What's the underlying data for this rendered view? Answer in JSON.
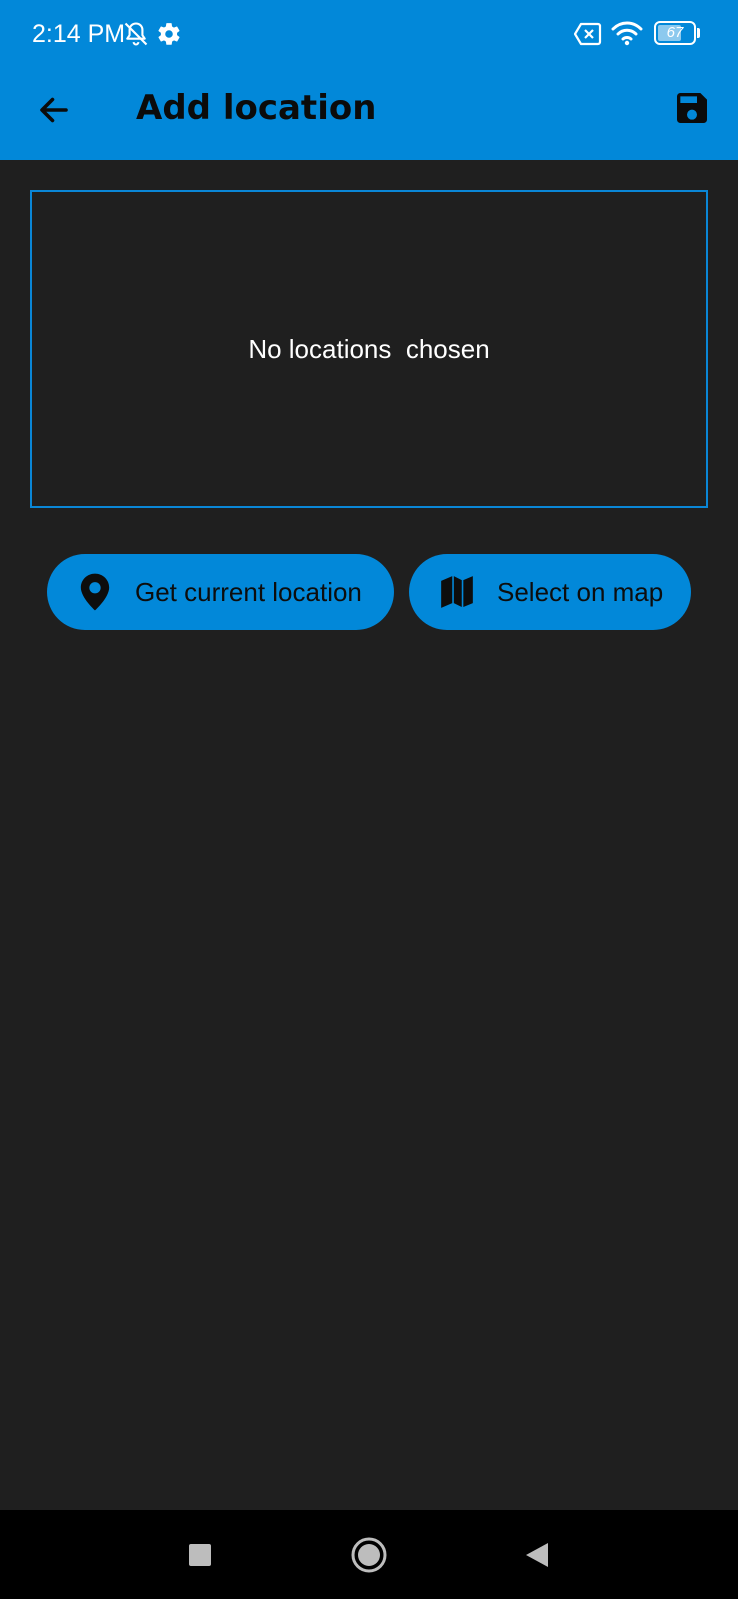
{
  "status_bar": {
    "time": "2:14 PM",
    "battery_level": "67",
    "icons": [
      "notifications-off-icon",
      "settings-gear-icon",
      "no-sim-icon",
      "wifi-icon",
      "battery-icon"
    ]
  },
  "toolbar": {
    "title": "Add location",
    "back_icon": "arrow-back-icon",
    "save_icon": "floppy-disk-icon"
  },
  "preview": {
    "empty_text": "No locations  chosen"
  },
  "actions": {
    "current_location": {
      "label": "Get current location",
      "icon": "location-pin-icon"
    },
    "select_on_map": {
      "label": "Select on map",
      "icon": "map-icon"
    }
  },
  "nav_bar": {
    "icons": [
      "recents-square-icon",
      "home-circle-icon",
      "back-triangle-icon"
    ]
  },
  "colors": {
    "accent": "#0288d9",
    "background": "#1f1f1f",
    "nav_background": "#000000",
    "text_on_dark": "#ffffff",
    "text_on_accent": "#0d0d0d"
  }
}
